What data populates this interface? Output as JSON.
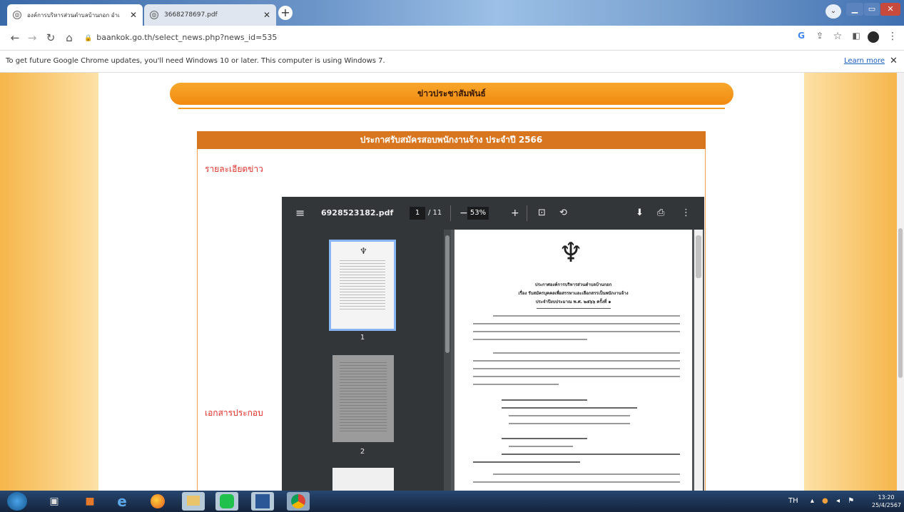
{
  "browser": {
    "tabs": [
      {
        "title": "องค์การบริหารส่วนตำบลบ้านกอก อำเ",
        "active": true
      },
      {
        "title": "3668278697.pdf",
        "active": false
      }
    ],
    "new_tab": "+",
    "url": "baankok.go.th/select_news.php?news_id=535",
    "info_message": "To get future Google Chrome updates, you'll need Windows 10 or later. This computer is using Windows 7.",
    "learn_more": "Learn more",
    "close_glyph": "✕"
  },
  "page": {
    "section_title": "ข่าวประชาสัมพันธ์",
    "news_title": "ประกาศรับสมัครสอบพนักงานจ้าง ประจำปี 2566",
    "detail_label": "รายละเอียดข่าว",
    "attachment_label": "เอกสารประกอบ"
  },
  "pdf_viewer": {
    "filename": "6928523182.pdf",
    "current_page": "1",
    "total_pages": "/ 11",
    "zoom": "53%",
    "thumbnails": [
      {
        "number": "1",
        "selected": true
      },
      {
        "number": "2",
        "selected": false
      }
    ],
    "document": {
      "heading_1": "ประกาศองค์การบริหารส่วนตำบลบ้านกอก",
      "heading_2": "เรื่อง รับสมัครบุคคลเพื่อสรรหาและเลือกสรรเป็นพนักงานจ้าง",
      "heading_3": "ประจำปีงบประมาณ พ.ศ. ๒๕๖๖ ครั้งที่ ๑"
    }
  },
  "taskbar": {
    "language": "TH",
    "time": "13:20",
    "date": "25/4/2567"
  },
  "colors": {
    "accent_orange": "#f18a10",
    "news_header": "#d8751f",
    "label_red": "#e0302a",
    "pdf_toolbar": "#323639"
  }
}
